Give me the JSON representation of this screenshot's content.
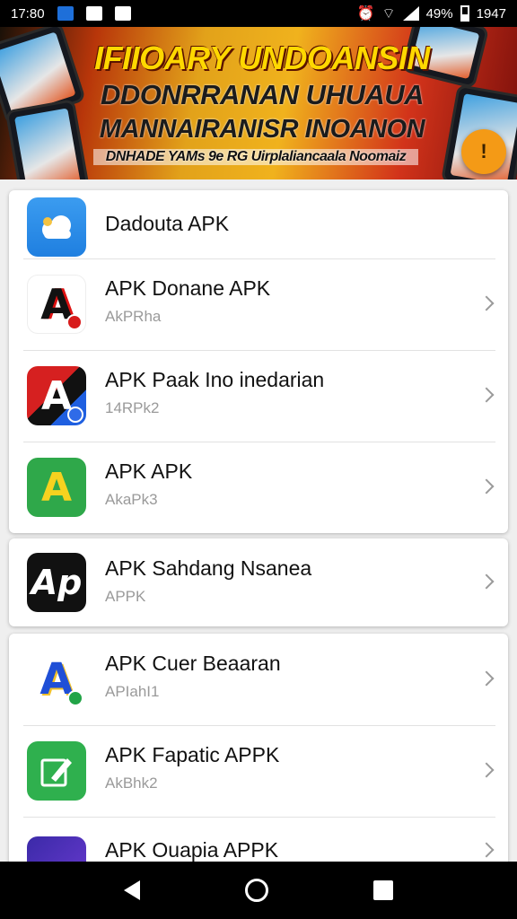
{
  "status_bar": {
    "time": "17:80",
    "battery": "49%",
    "clock_right": "1947"
  },
  "banner": {
    "line1": "IFIIOARY UNDOANSIN",
    "line2": "DDONRRANAN UHUAUA",
    "line3": "MANNAIRANISR INOANON",
    "line4": "DNHADE YAMs 9e RG Uirplaliancaala Noomaiz",
    "alert_label": "!"
  },
  "cards": [
    {
      "items": [
        {
          "title": "Dadouta APK",
          "subtitle": "",
          "icon": "cloud-app-icon",
          "has_chevron": false
        },
        {
          "title": "APK Donane APK",
          "subtitle": "AkPRha",
          "icon": "letter-a-red-app-icon",
          "has_chevron": true
        },
        {
          "title": "APK Paak Ino inedarian",
          "subtitle": "14RPk2",
          "icon": "letter-a-flag-app-icon",
          "has_chevron": true
        }
      ]
    },
    {
      "items": [
        {
          "title": "APK APK",
          "subtitle": "AkaPk3",
          "icon": "green-a-app-icon",
          "has_chevron": true
        }
      ]
    },
    {
      "items": [
        {
          "title": "APK Sahdang Nsanea",
          "subtitle": "APPK",
          "icon": "black-ap-app-icon",
          "has_chevron": true
        }
      ]
    },
    {
      "items": [
        {
          "title": "APK Cuer Beaaran",
          "subtitle": "APIahI1",
          "icon": "blue-a-app-icon",
          "has_chevron": true
        },
        {
          "title": "APK Fapatic APPK",
          "subtitle": "AkBhk2",
          "icon": "green-edit-app-icon",
          "has_chevron": true
        },
        {
          "title": "APK Ouapia APPK",
          "subtitle": "",
          "icon": "purple-app-icon",
          "has_chevron": true
        }
      ]
    }
  ],
  "colors": {
    "accent_orange": "#f49a16",
    "chevron_gray": "#9a9a9a",
    "card_bg": "#ffffff",
    "page_bg": "#efefef"
  }
}
